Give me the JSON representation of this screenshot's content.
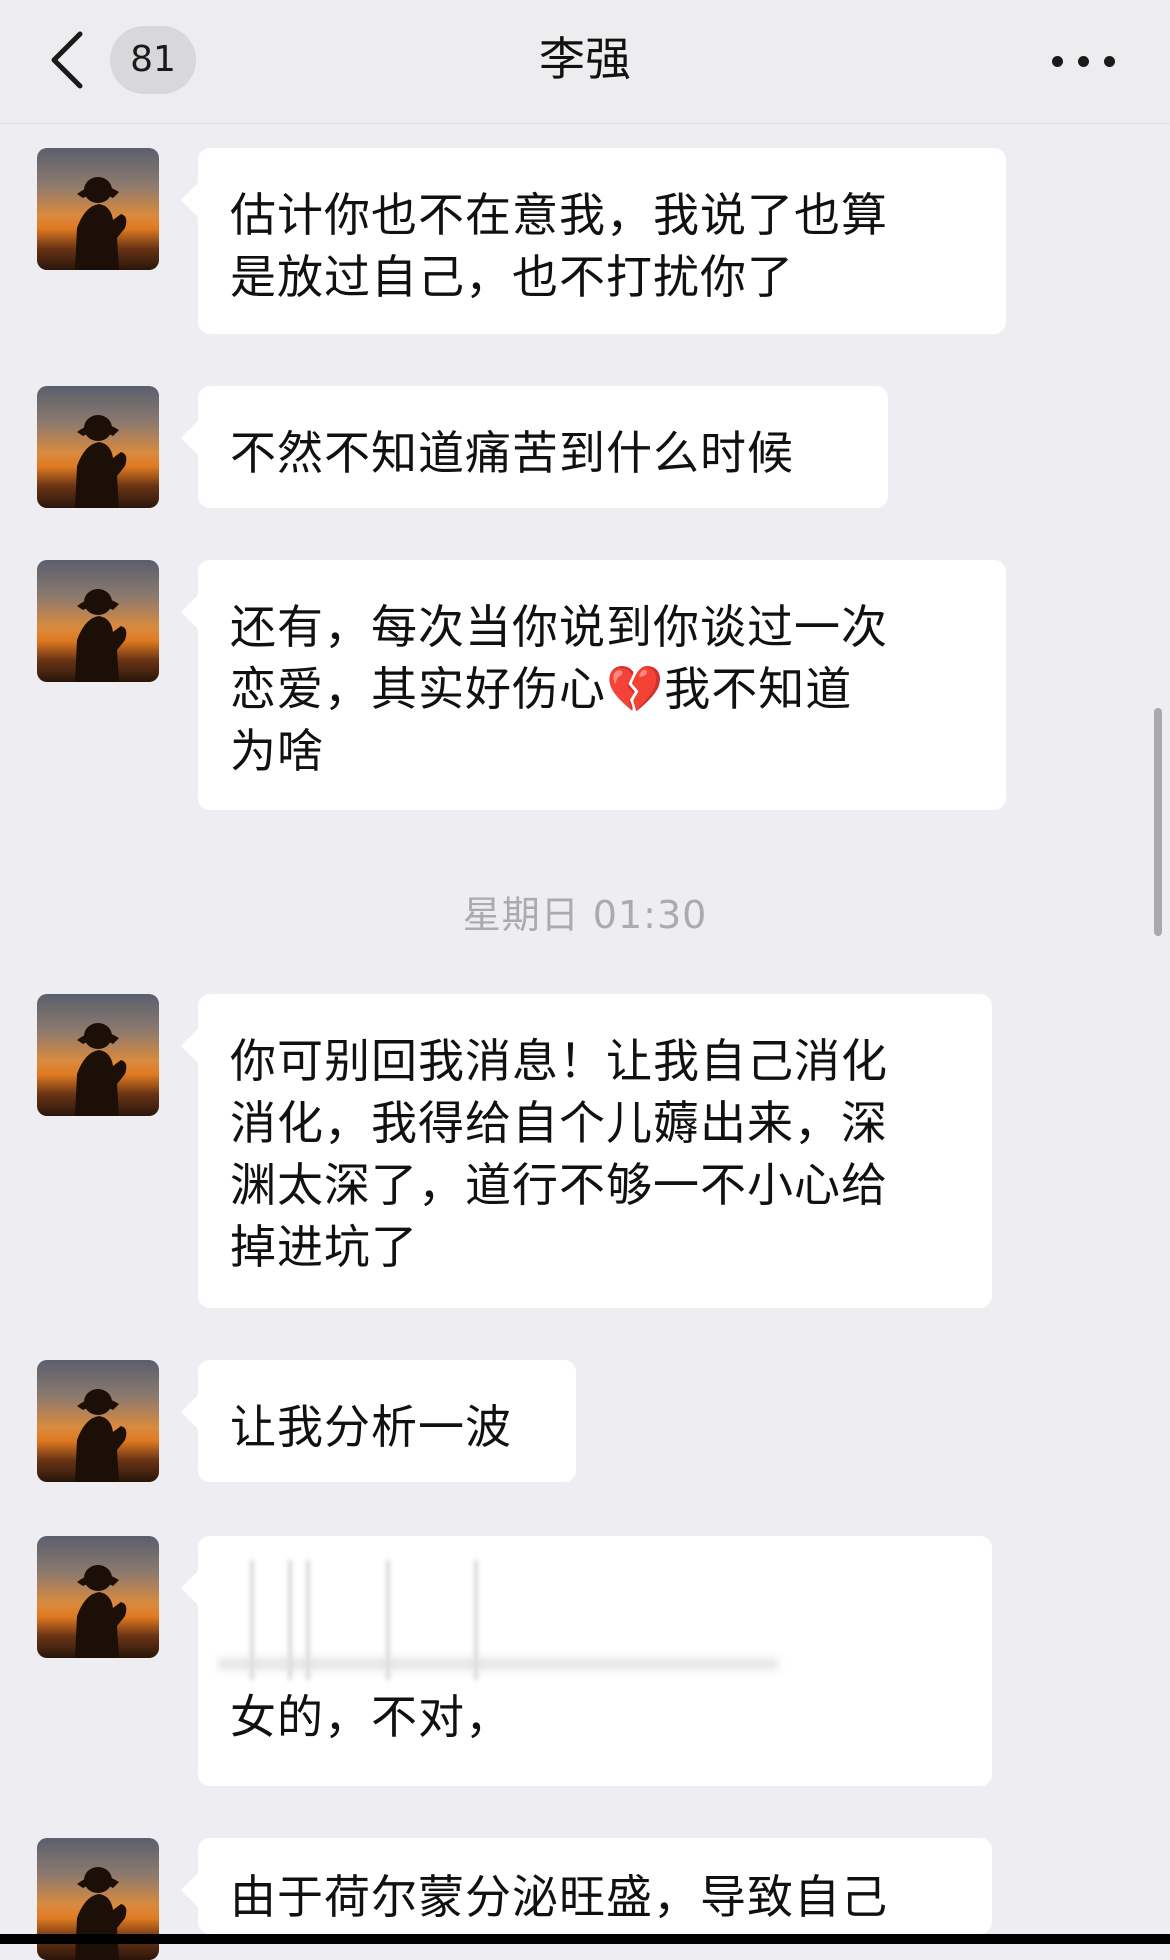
{
  "header": {
    "unread_count": "81",
    "contact_name": "李强"
  },
  "messages": [
    {
      "text": "估计你也不在意我，我说了也算\n是放过自己，也不打扰你了"
    },
    {
      "text": "不然不知道痛苦到什么时候"
    },
    {
      "text": "还有，每次当你说到你谈过一次\n恋爱，其实好伤心💔我不知道\n为啥"
    },
    {
      "text": "你可别回我消息！让我自己消化\n消化，我得给自个儿薅出来，深\n渊太深了，道行不够一不小心给\n掉进坑了"
    },
    {
      "text": "让我分析一波"
    },
    {
      "text": "女的，不对，"
    },
    {
      "text": "由于荷尔蒙分泌旺盛，导致自己"
    }
  ],
  "timestamp": "星期日 01:30",
  "colors": {
    "background": "#eeedf1",
    "bubble": "#ffffff",
    "timestamp_text": "#ababaf"
  }
}
